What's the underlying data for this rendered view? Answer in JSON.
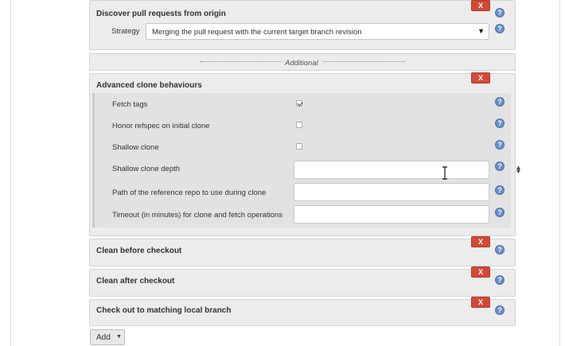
{
  "discover_pr": {
    "title": "Discover pull requests from origin",
    "strategy_label": "Strategy",
    "strategy_value": "Merging the pull request with the current target branch revision"
  },
  "additional_label": "Additional",
  "advanced_clone": {
    "title": "Advanced clone behaviours",
    "fields": {
      "fetch_tags": "Fetch tags",
      "honor_refspec": "Honor refspec on initial clone",
      "shallow_clone": "Shallow clone",
      "shallow_depth": "Shallow clone depth",
      "reference_repo": "Path of the reference repo to use during clone",
      "timeout": "Timeout (in minutes) for clone and fetch operations"
    },
    "checkbox_states": {
      "fetch_tags": true,
      "honor_refspec": false,
      "shallow_clone": false
    },
    "inputs": {
      "shallow_depth": "",
      "reference_repo": "",
      "timeout": ""
    }
  },
  "clean_before": {
    "title": "Clean before checkout"
  },
  "clean_after": {
    "title": "Clean after checkout"
  },
  "checkout_local": {
    "title": "Check out to matching local branch"
  },
  "delete_label": "X",
  "help_label": "?",
  "add_button": {
    "label": "Add",
    "caret": "▼"
  },
  "select_arrow": "▼",
  "spinner": {
    "up": "▲",
    "down": "▼"
  },
  "colors": {
    "delete": "#d24939",
    "help": "#6a8fc7",
    "panel": "#ececec"
  }
}
